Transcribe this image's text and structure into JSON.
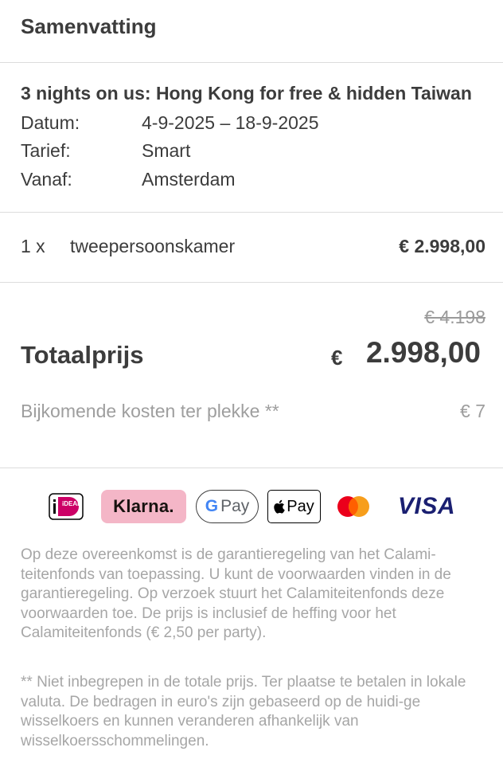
{
  "header": {
    "title": "Samenvatting"
  },
  "trip": {
    "title": "3 nights on us: Hong Kong for free & hidden Taiwan",
    "details": [
      {
        "label": "Datum:",
        "value": "4-9-2025 – 18-9-2025"
      },
      {
        "label": "Tarief:",
        "value": "Smart"
      },
      {
        "label": "Vanaf:",
        "value": "Amsterdam"
      }
    ]
  },
  "line_item": {
    "quantity": "1 x",
    "description": "tweepersoonskamer",
    "price": "€ 2.998,00"
  },
  "totals": {
    "old_price": "€ 4.198",
    "label": "Totaalprijs",
    "currency": "€",
    "amount": "2.998,00",
    "extra_label": "Bijkomende kosten ter plekke **",
    "extra_value": "€ 7"
  },
  "payment_methods": {
    "ideal": "iDEAL",
    "klarna": "Klarna.",
    "gpay": "Pay",
    "applepay": "Pay",
    "visa": "VISA"
  },
  "disclaimers": {
    "calamiteitenfonds": "Op deze overeenkomst is de garantieregeling van het Calami-teitenfonds van toepassing. U kunt de voorwaarden vinden in de garantieregeling. Op verzoek stuurt het Calamiteitenfonds deze voorwaarden toe. De prijs is inclusief de heffing voor het Calamiteitenfonds (€ 2,50 per party).",
    "local_costs": "** Niet inbegrepen in de totale prijs. Ter plaatse te betalen in lokale valuta. De bedragen in euro's zijn gebaseerd op de huidi-ge wisselkoers en kunnen veranderen afhankelijk van wisselkoersschommelingen."
  },
  "colors": {
    "text": "#3c3c3c",
    "muted": "#9e9e9e",
    "divider": "#dcdcdc",
    "klarna_pink": "#f4b6c7",
    "ideal_pink": "#cc0066",
    "visa_blue": "#1a1f71",
    "mastercard_red": "#eb001b",
    "mastercard_orange": "#f79e1b"
  }
}
